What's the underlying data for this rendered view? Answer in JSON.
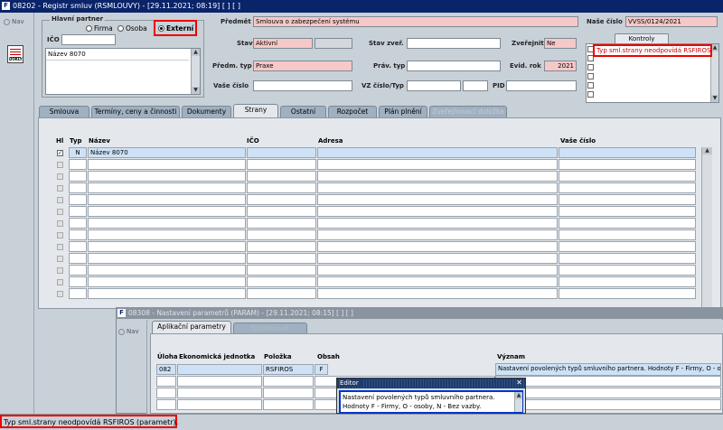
{
  "window": {
    "title": "08202 - Registr smluv (RSMLOUVY) - [29.11.2021; 08:19]  [ ]  [ ]",
    "logo": "F"
  },
  "nav": {
    "label": "Nav",
    "doc_icon_text": "DOKLY"
  },
  "partner": {
    "group_label": "Hlavní partner",
    "radio_firma": "Firma",
    "radio_osoba": "Osoba",
    "radio_externi": "Externí",
    "ico_label": "IČO",
    "ico_value": "",
    "name_value": "Název 8070"
  },
  "header": {
    "predmet_label": "Předmět",
    "predmet_value": "Smlouva o zabezpečení systému",
    "nase_cislo_label": "Naše číslo",
    "nase_cislo_value": "VVSS/0124/2021",
    "stav_label": "Stav",
    "stav_value": "Aktivní",
    "stav_zver_label": "Stav zveř.",
    "stav_zver_value": "",
    "zverejnit_label": "Zveřejnit",
    "zverejnit_value": "Ne",
    "kontroly_button": "Kontroly",
    "predm_typ_label": "Předm. typ",
    "predm_typ_value": "Praxe",
    "prav_typ_label": "Práv. typ",
    "prav_typ_value": "",
    "evid_rok_label": "Evid. rok",
    "evid_rok_value": "2021",
    "vase_cislo_label": "Vaše číslo",
    "vase_cislo_value": "",
    "vz_cislo_label": "VZ číslo/Typ",
    "pid_label": "PID",
    "pid_value": "",
    "kontroly_message": "Typ sml.strany neodpovídá RSFIROS"
  },
  "tabs": [
    {
      "label": "Smlouva"
    },
    {
      "label": "Termíny, ceny a činnosti"
    },
    {
      "label": "Dokumenty"
    },
    {
      "label": "Strany"
    },
    {
      "label": "Ostatní"
    },
    {
      "label": "Rozpočet"
    },
    {
      "label": "Plán plnění"
    },
    {
      "label": "Zveřejňovací doložka"
    }
  ],
  "strany": {
    "columns": {
      "hl": "Hl",
      "typ": "Typ",
      "nazev": "Název",
      "ico": "IČO",
      "adresa": "Adresa",
      "vase_cislo": "Vaše číslo"
    },
    "rows": [
      {
        "hl": "✓",
        "typ": "N",
        "nazev": "Název 8070",
        "ico": "",
        "adresa": "",
        "vase_cislo": ""
      }
    ]
  },
  "param_window": {
    "title": "08308 - Nastavení parametrů (PARAM) - [29.11.2021; 08:15]  [ ]  [ ]",
    "nav_label": "Nav",
    "tab_aplikacni": "Aplikační parametry",
    "tab_systemove": "Systémové parametry",
    "columns": {
      "uloha": "Úloha",
      "ekon": "Ekonomická jednotka",
      "polozka": "Položka",
      "obsah": "Obsah",
      "vyznam": "Význam"
    },
    "row": {
      "uloha": "082",
      "ekon": "",
      "polozka": "RSFIROS",
      "obsah": "F",
      "vyznam": "Nastavení povolených typů smluvního partnera. Hodnoty F - Firmy, O - osoby, N - Bez vazby."
    }
  },
  "editor": {
    "title": "Editor",
    "close": "✕",
    "line1": "Nastavení povolených typů smluvního partnera.",
    "line2": "Hodnoty F - Firmy, O - osoby, N - Bez vazby."
  },
  "status": {
    "text": "Typ sml.strany neodpovídá RSFIROS (parametr)."
  },
  "colors": {
    "error": "#e00000",
    "highlight_blue": "#0033cc",
    "title_bg": "#0a246a",
    "pink_field": "#f6c8c8"
  }
}
